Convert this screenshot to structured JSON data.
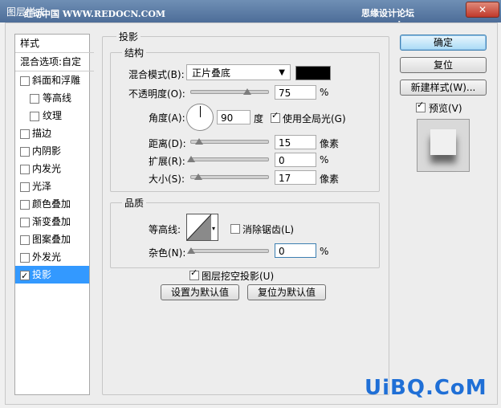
{
  "window": {
    "title": "图层样式",
    "watermark_left": "红动中国 WWW.REDOCN.COM",
    "watermark_right": "思缘设计论坛 www.missyuan.com",
    "close_label": "✕"
  },
  "left_panel": {
    "styles_header": "样式",
    "blend_options": "混合选项:自定",
    "items": [
      {
        "label": "斜面和浮雕",
        "checked": false,
        "indent": false
      },
      {
        "label": "等高线",
        "checked": false,
        "indent": true
      },
      {
        "label": "纹理",
        "checked": false,
        "indent": true
      },
      {
        "label": "描边",
        "checked": false,
        "indent": false
      },
      {
        "label": "内阴影",
        "checked": false,
        "indent": false
      },
      {
        "label": "内发光",
        "checked": false,
        "indent": false
      },
      {
        "label": "光泽",
        "checked": false,
        "indent": false
      },
      {
        "label": "颜色叠加",
        "checked": false,
        "indent": false
      },
      {
        "label": "渐变叠加",
        "checked": false,
        "indent": false
      },
      {
        "label": "图案叠加",
        "checked": false,
        "indent": false
      },
      {
        "label": "外发光",
        "checked": false,
        "indent": false
      },
      {
        "label": "投影",
        "checked": true,
        "indent": false,
        "selected": true
      }
    ]
  },
  "drop_shadow": {
    "title": "投影",
    "structure": {
      "title": "结构",
      "blend_mode_label": "混合模式(B):",
      "blend_mode_value": "正片叠底",
      "shadow_color": "#000000",
      "opacity_label": "不透明度(O):",
      "opacity_value": "75",
      "opacity_unit": "%",
      "angle_label": "角度(A):",
      "angle_value": "90",
      "angle_unit": "度",
      "global_light_label": "使用全局光(G)",
      "global_light_checked": true,
      "distance_label": "距离(D):",
      "distance_value": "15",
      "distance_unit": "像素",
      "spread_label": "扩展(R):",
      "spread_value": "0",
      "spread_unit": "%",
      "size_label": "大小(S):",
      "size_value": "17",
      "size_unit": "像素"
    },
    "quality": {
      "title": "品质",
      "contour_label": "等高线:",
      "anti_alias_label": "消除锯齿(L)",
      "anti_alias_checked": false,
      "noise_label": "杂色(N):",
      "noise_value": "0",
      "noise_unit": "%"
    },
    "knockout_label": "图层挖空投影(U)",
    "knockout_checked": true,
    "make_default": "设置为默认值",
    "reset_default": "复位为默认值"
  },
  "right": {
    "ok": "确定",
    "reset": "复位",
    "new_style": "新建样式(W)...",
    "preview_label": "预览(V)",
    "preview_checked": true
  },
  "footer": {
    "watermark": "红动中国 WWW.REDOCN.COM",
    "logo": "UiBQ.CoM"
  }
}
